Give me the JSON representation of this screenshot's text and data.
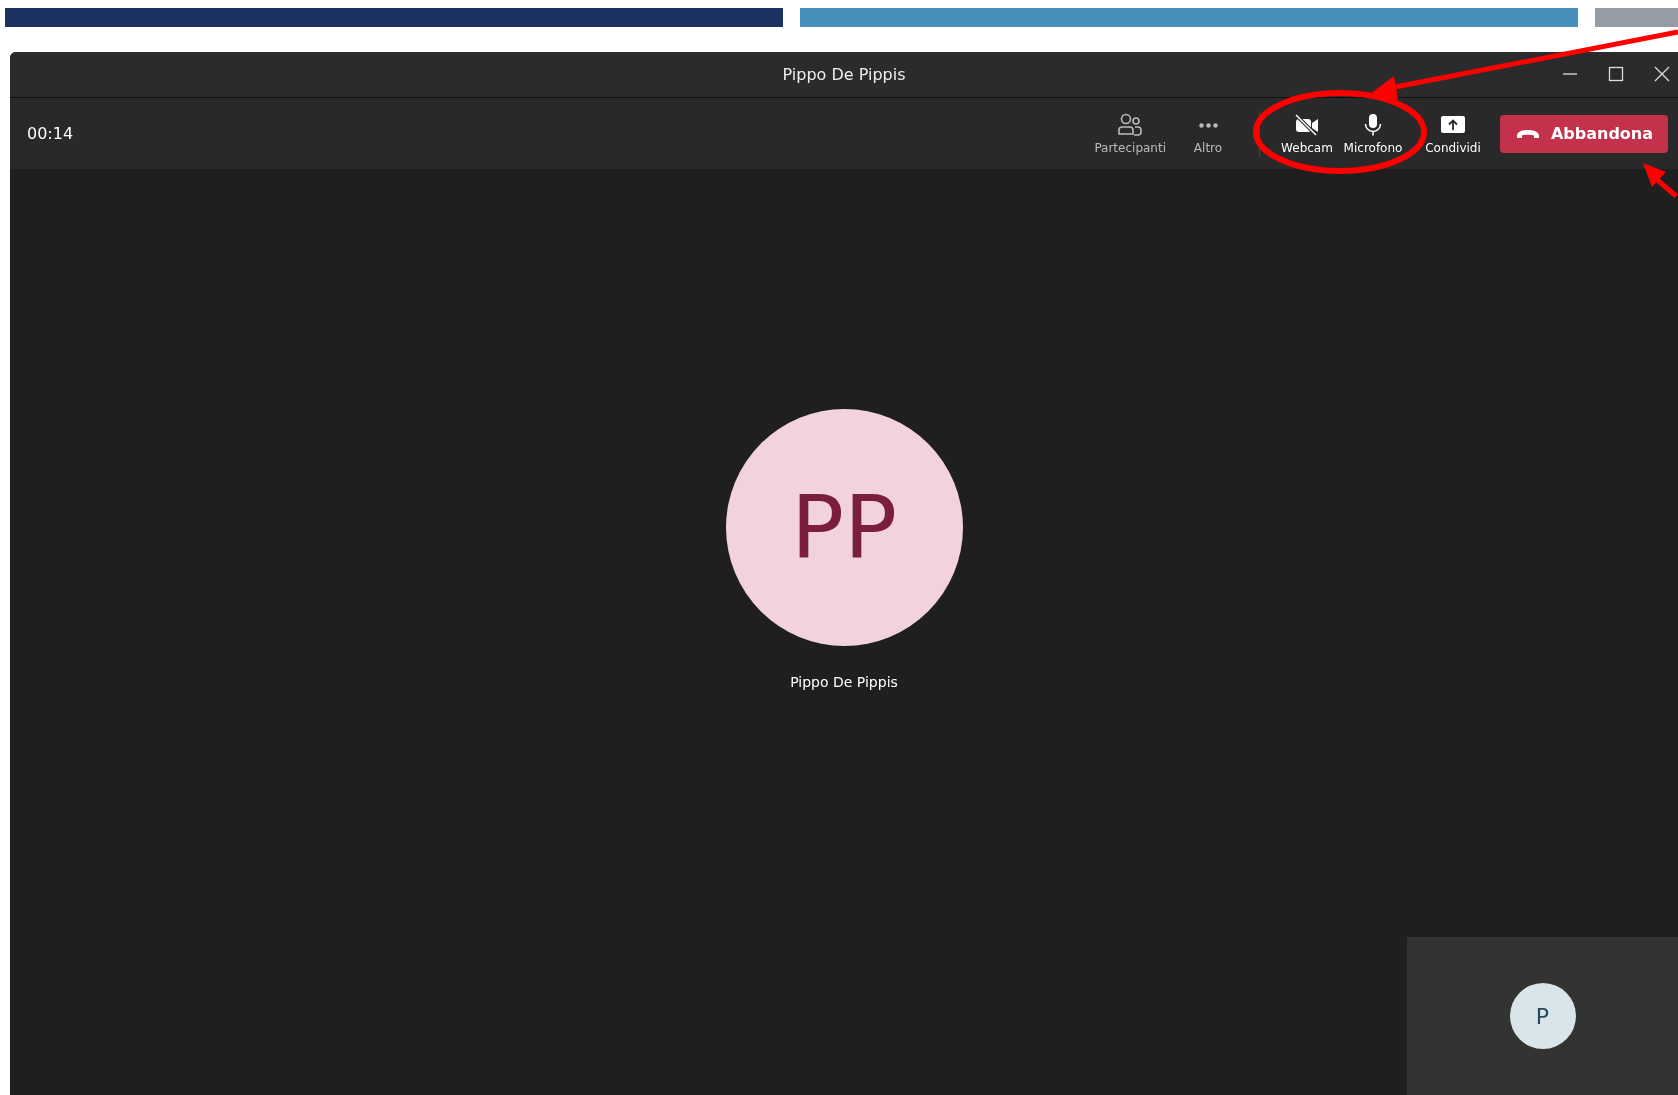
{
  "window": {
    "title": "Pippo De Pippis"
  },
  "toolbar": {
    "timer": "00:14",
    "actions": [
      {
        "kind": "participants",
        "label": "Partecipanti"
      },
      {
        "kind": "more",
        "label": "Altro"
      }
    ],
    "devices": [
      {
        "kind": "camera",
        "label": "Webcam",
        "on": false
      },
      {
        "kind": "microphone",
        "label": "Microfono",
        "on": true
      }
    ],
    "share": {
      "label": "Condividi"
    },
    "leave": {
      "label": "Abbandona"
    }
  },
  "stage": {
    "participant": {
      "initials": "PP",
      "name": "Pippo De Pippis"
    },
    "self_view": {
      "initials": "P"
    }
  }
}
